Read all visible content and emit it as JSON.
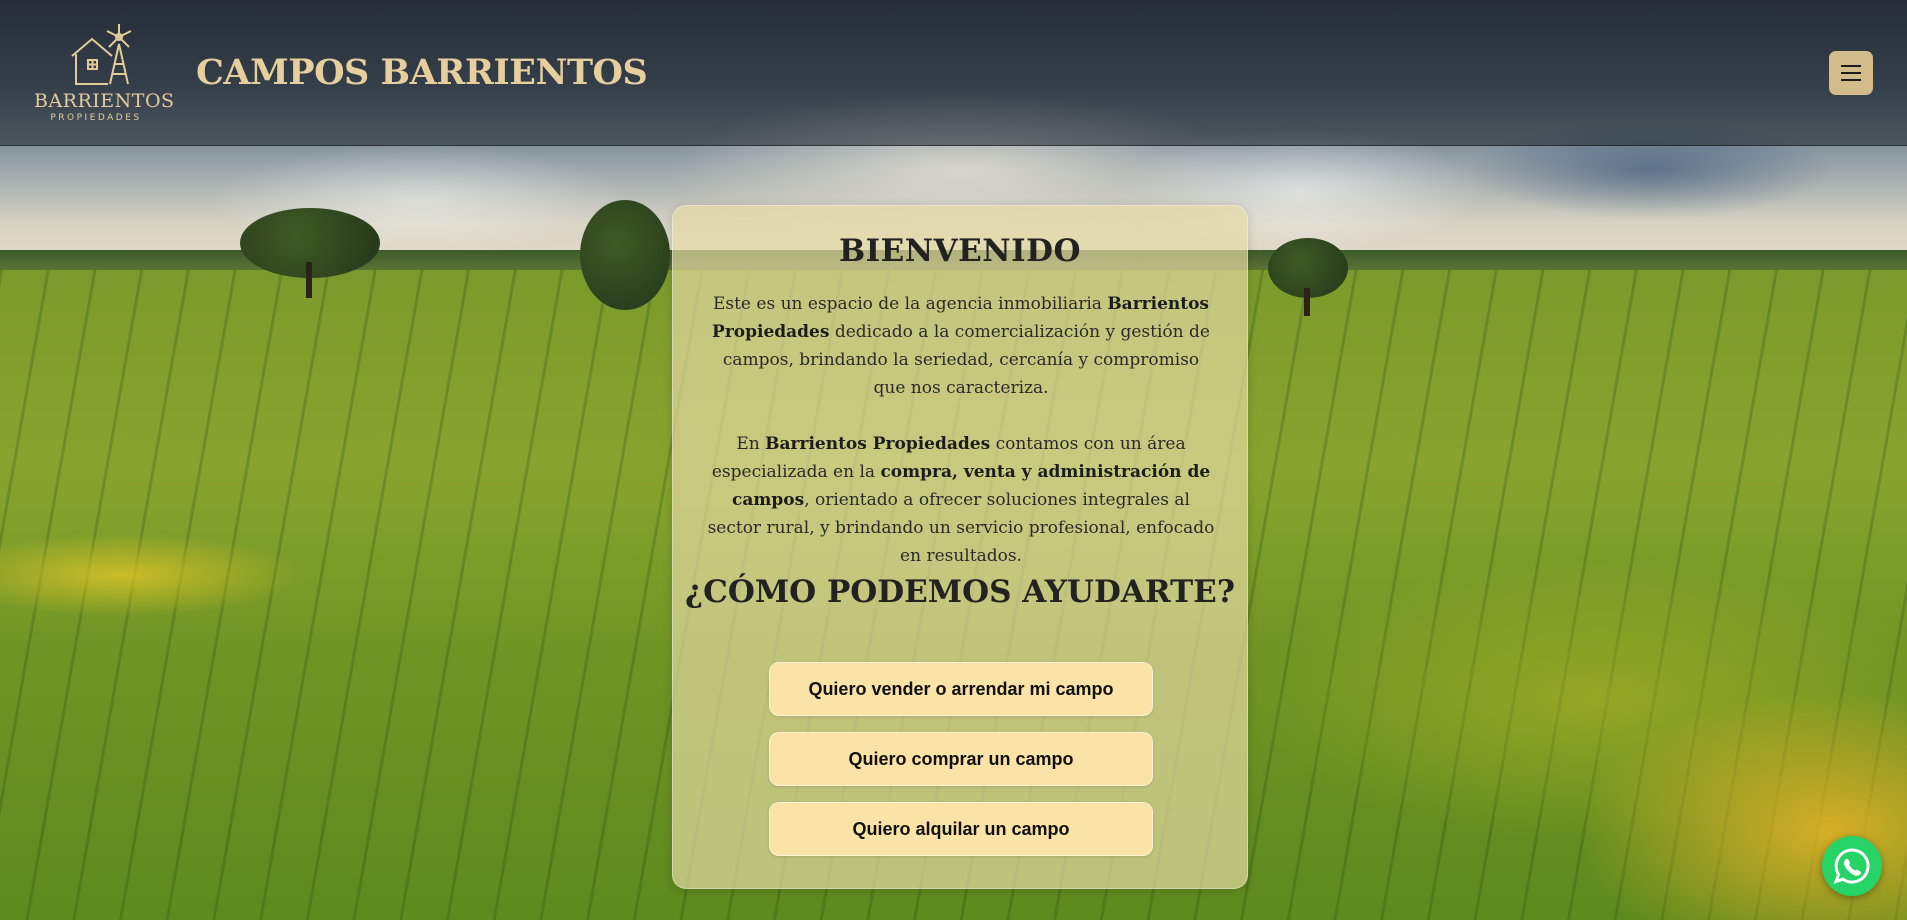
{
  "header": {
    "logo_word": "BARRIENTOS",
    "logo_sub": "PROPIEDADES",
    "site_title": "CAMPOS BARRIENTOS",
    "menu_icon": "hamburger-menu-icon"
  },
  "welcome": {
    "title": "BIENVENIDO",
    "paragraph1": {
      "t1": "Este es un espacio de la agencia inmobiliaria ",
      "b1": "Barrientos Propiedades",
      "t2": " dedicado a la comercialización y gestión de campos, brindando la seriedad, cercanía y compromiso que nos caracteriza."
    },
    "paragraph2": {
      "t1": "En ",
      "b1": "Barrientos Propiedades",
      "t2": " contamos con un área especializada en la ",
      "b2": "compra, venta y administración de campos",
      "t3": ", orientado a ofrecer soluciones integrales al sector rural, y brindando un servicio profesional, enfocado en resultados."
    },
    "help_title": "¿CÓMO PODEMOS AYUDARTE?",
    "options": [
      "Quiero vender o arrendar mi campo",
      "Quiero comprar un campo",
      "Quiero alquilar un campo"
    ]
  },
  "whatsapp": {
    "icon": "whatsapp-icon"
  },
  "colors": {
    "accent_gold": "#d3bc8c",
    "button_fill": "#fbe2a7",
    "whatsapp_green": "#25d366"
  }
}
